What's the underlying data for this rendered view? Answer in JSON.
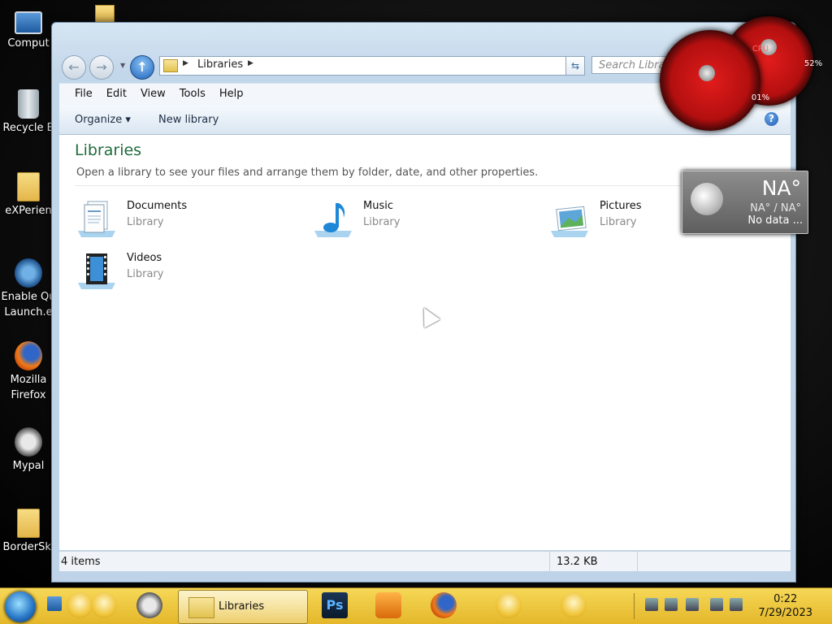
{
  "desktop": {
    "icons": [
      {
        "label": "Comput"
      },
      {
        "label": "Recycle B"
      },
      {
        "label": "eXPerien"
      },
      {
        "label": "Enable Qu",
        "label2": "Launch.e"
      },
      {
        "label": "Mozilla",
        "label2": "Firefox"
      },
      {
        "label": "Mypal"
      },
      {
        "label": "BorderSki"
      }
    ]
  },
  "window": {
    "address": {
      "crumb": "Libraries"
    },
    "search": {
      "placeholder": "Search Libra"
    },
    "menu": [
      "File",
      "Edit",
      "View",
      "Tools",
      "Help"
    ],
    "commands": {
      "organize": "Organize ▾",
      "new_library": "New library"
    },
    "content": {
      "title": "Libraries",
      "description": "Open a library to see your files and arrange them by folder, date, and other properties.",
      "libraries": [
        {
          "name": "Documents",
          "type": "Library",
          "icon": "documents-icon"
        },
        {
          "name": "Music",
          "type": "Library",
          "icon": "music-icon"
        },
        {
          "name": "Pictures",
          "type": "Library",
          "icon": "pictures-icon"
        },
        {
          "name": "Videos",
          "type": "Library",
          "icon": "videos-icon"
        }
      ]
    },
    "status": {
      "items": "4 items",
      "size": "13.2 KB"
    }
  },
  "gadgets": {
    "cpu_gauge": {
      "label": "CPU",
      "value": "01%"
    },
    "mem_gauge": {
      "value": "52%"
    },
    "weather": {
      "temp": "NA°",
      "range": "NA° / NA°",
      "status": "No data ..."
    }
  },
  "taskbar": {
    "active_task": "Libraries",
    "ps_label": "Ps",
    "clock": {
      "time": "0:22",
      "date": "7/29/2023"
    }
  },
  "colors": {
    "title_green": "#1e6b3c",
    "taskbar_yellow": "#f6d857",
    "gauge_red": "#e21c1c"
  }
}
